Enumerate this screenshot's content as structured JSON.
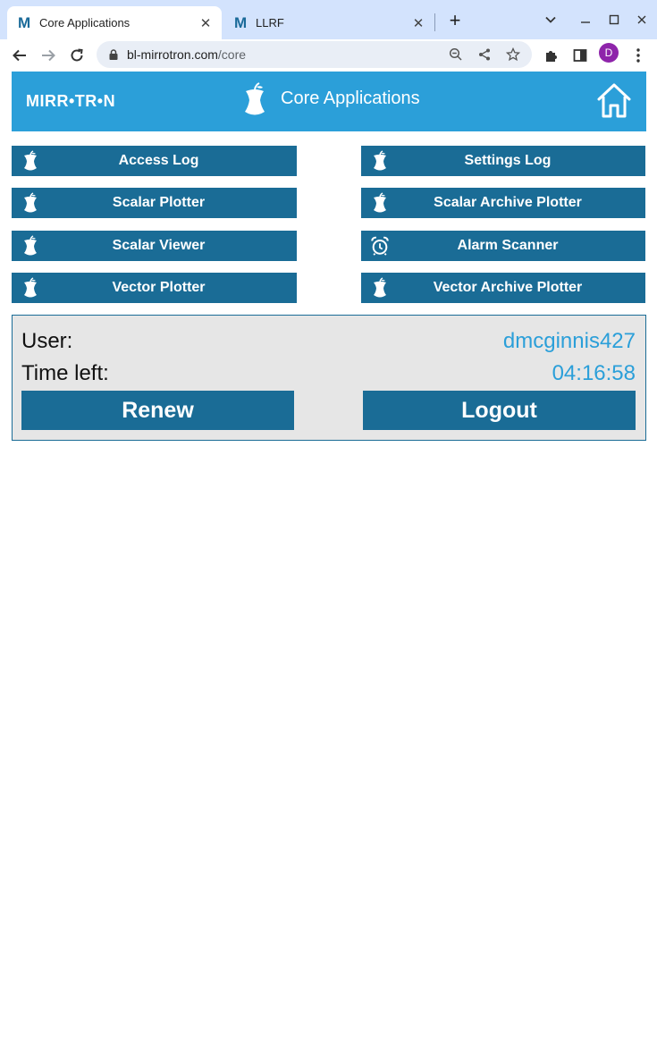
{
  "browser": {
    "tabs": [
      {
        "favicon": "M",
        "title": "Core Applications",
        "active": true
      },
      {
        "favicon": "M",
        "title": "LLRF",
        "active": false
      }
    ],
    "url_host": "bl-mirrotron.com",
    "url_path": "/core",
    "profile_initial": "D"
  },
  "header": {
    "brand": "MIRR•TR•N",
    "title": "Core Applications"
  },
  "apps": [
    {
      "label": "Access Log",
      "icon": "apple-core-icon"
    },
    {
      "label": "Settings Log",
      "icon": "apple-core-icon"
    },
    {
      "label": "Scalar Plotter",
      "icon": "apple-core-icon"
    },
    {
      "label": "Scalar Archive Plotter",
      "icon": "apple-core-icon"
    },
    {
      "label": "Scalar Viewer",
      "icon": "apple-core-icon"
    },
    {
      "label": "Alarm Scanner",
      "icon": "alarm-clock-icon"
    },
    {
      "label": "Vector Plotter",
      "icon": "apple-core-icon"
    },
    {
      "label": "Vector Archive Plotter",
      "icon": "apple-core-icon"
    }
  ],
  "session": {
    "user_label": "User:",
    "user_value": "dmcginnis427",
    "time_label": "Time left:",
    "time_value": "04:16:58",
    "renew_label": "Renew",
    "logout_label": "Logout"
  },
  "colors": {
    "header_bg": "#2b9fd9",
    "button_bg": "#1a6c96",
    "accent_text": "#2b9fd9"
  }
}
